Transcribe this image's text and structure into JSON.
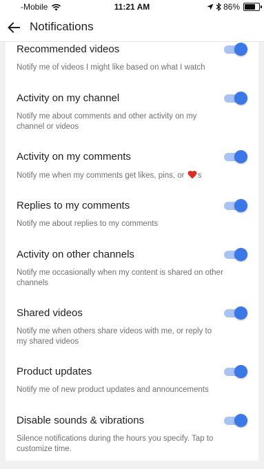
{
  "status_bar": {
    "carrier": "-Mobile",
    "time": "11:21 AM",
    "battery": "86%",
    "battery_level": 0.86
  },
  "app_bar": {
    "back_icon": "arrow-left-icon",
    "title": "Notifications"
  },
  "settings": [
    {
      "title": "Recommended videos",
      "description": "Notify me of videos I might like based on what I watch",
      "enabled": true
    },
    {
      "title": "Activity on my channel",
      "description": "Notify me about comments and other activity on my channel or videos",
      "enabled": true
    },
    {
      "title": "Activity on my comments",
      "description_before": "Notify me when my comments get likes, pins, or ",
      "description_icon": "heart-icon",
      "description_after": "s",
      "enabled": true
    },
    {
      "title": "Replies to my comments",
      "description": "Notify me about replies to my comments",
      "enabled": true
    },
    {
      "title": "Activity on other channels",
      "description": "Notify me occasionally when my content is shared on other channels",
      "enabled": true
    },
    {
      "title": "Shared videos",
      "description": "Notify me when others share videos with me, or reply to my shared videos",
      "enabled": true
    },
    {
      "title": "Product updates",
      "description": "Notify me of new product updates and announcements",
      "enabled": true
    },
    {
      "title": "Disable sounds & vibrations",
      "description": "Silence notifications during the hours you specify. Tap to customize time.",
      "enabled": true
    }
  ],
  "colors": {
    "toggle_on_knob": "#3b78e7",
    "toggle_on_track": "#a9c3f5",
    "heart": "#d93025"
  }
}
